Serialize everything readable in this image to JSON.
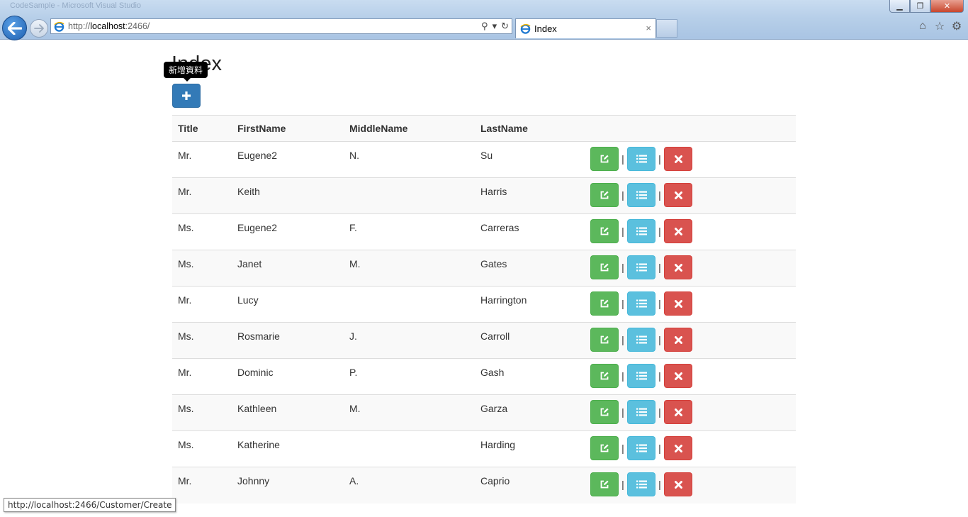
{
  "browser": {
    "window_title": "CodeSample - Microsoft Visual Studio",
    "address": {
      "scheme": "http://",
      "host": "localhost",
      "rest": ":2466/"
    },
    "tab_label": "Index",
    "tab_close": "×",
    "win_min": "▁",
    "win_max": "❐",
    "win_close": "✕"
  },
  "page": {
    "title": "Index",
    "create_tooltip": "新增資料",
    "status_url": "http://localhost:2466/Customer/Create"
  },
  "table": {
    "headers": [
      "Title",
      "FirstName",
      "MiddleName",
      "LastName"
    ],
    "separator": "|",
    "rows": [
      {
        "title": "Mr.",
        "first": "Eugene2",
        "middle": "N.",
        "last": "Su"
      },
      {
        "title": "Mr.",
        "first": "Keith",
        "middle": "",
        "last": "Harris"
      },
      {
        "title": "Ms.",
        "first": "Eugene2",
        "middle": "F.",
        "last": "Carreras"
      },
      {
        "title": "Ms.",
        "first": "Janet",
        "middle": "M.",
        "last": "Gates"
      },
      {
        "title": "Mr.",
        "first": "Lucy",
        "middle": "",
        "last": "Harrington"
      },
      {
        "title": "Ms.",
        "first": "Rosmarie",
        "middle": "J.",
        "last": "Carroll"
      },
      {
        "title": "Mr.",
        "first": "Dominic",
        "middle": "P.",
        "last": "Gash"
      },
      {
        "title": "Ms.",
        "first": "Kathleen",
        "middle": "M.",
        "last": "Garza"
      },
      {
        "title": "Ms.",
        "first": "Katherine",
        "middle": "",
        "last": "Harding"
      },
      {
        "title": "Mr.",
        "first": "Johnny",
        "middle": "A.",
        "last": "Caprio"
      }
    ]
  },
  "icons": {
    "back": "back-arrow-icon",
    "create": "plus-icon",
    "edit": "edit-icon",
    "detail": "list-icon",
    "delete": "remove-icon"
  },
  "colors": {
    "primary": "#337ab7",
    "success": "#5cb85c",
    "info": "#5bc0de",
    "danger": "#d9534f"
  }
}
